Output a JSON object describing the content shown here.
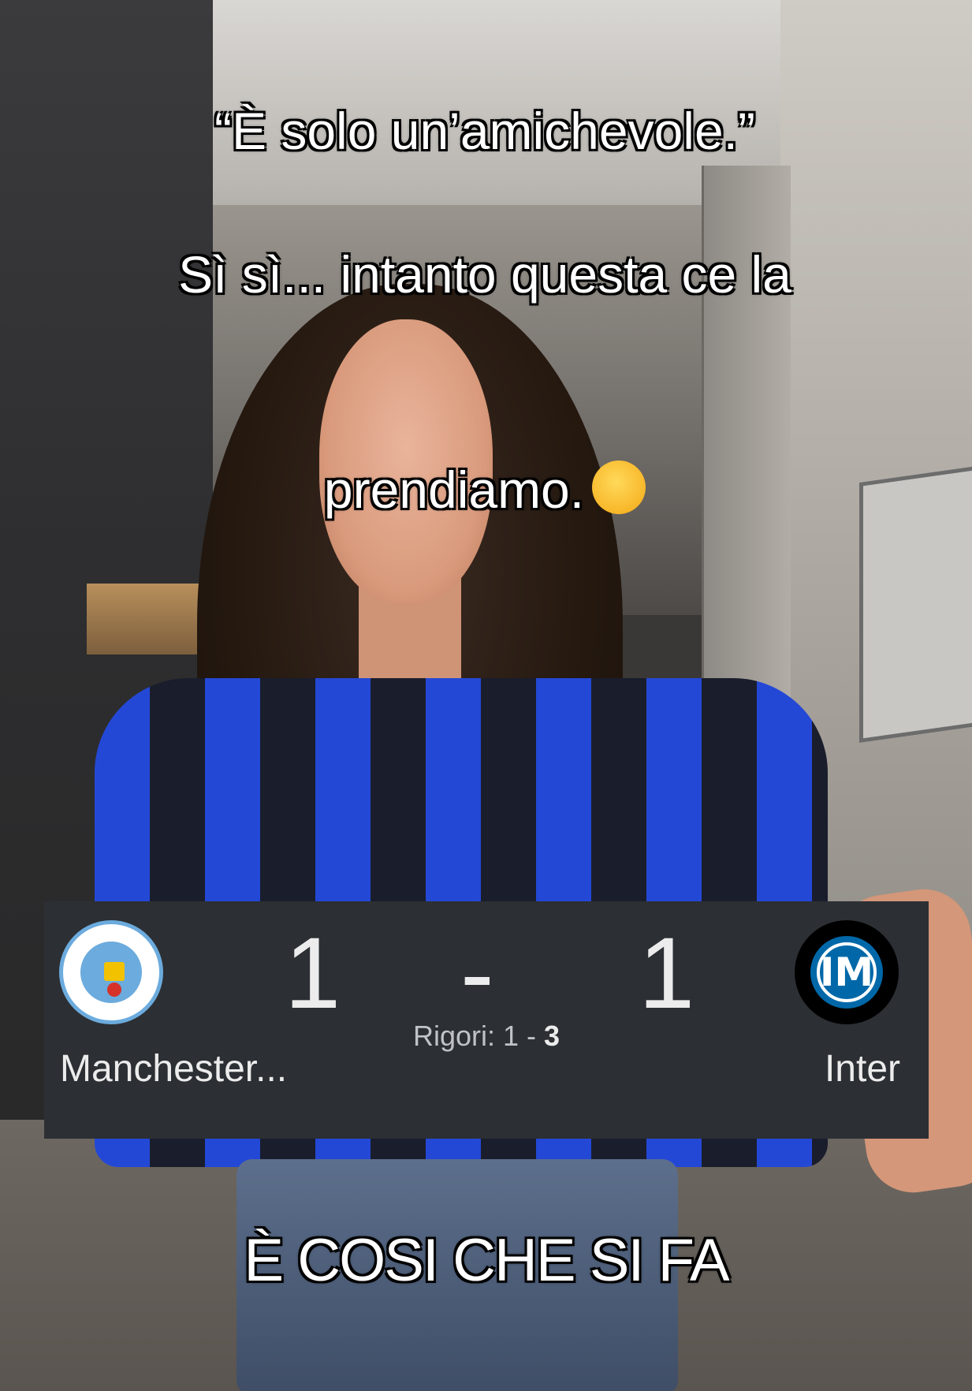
{
  "caption_top": {
    "line1": "“È solo un’amichevole.”",
    "line2": "Sì sì... intanto questa ce la",
    "line3": "prendiamo.",
    "emoji": "relieved-face-emoji"
  },
  "caption_bottom": "È COSI CHE SI FA",
  "score_card": {
    "home_team": "Manchester...",
    "away_team": "Inter",
    "home_score": "1",
    "away_score": "1",
    "separator": "-",
    "penalties_label": "Rigori: ",
    "penalties_home": "1",
    "penalties_sep": " - ",
    "penalties_away": "3",
    "home_crest": "manchester-city-crest",
    "away_crest": "inter-crest",
    "background_color": "#2c2f33"
  }
}
